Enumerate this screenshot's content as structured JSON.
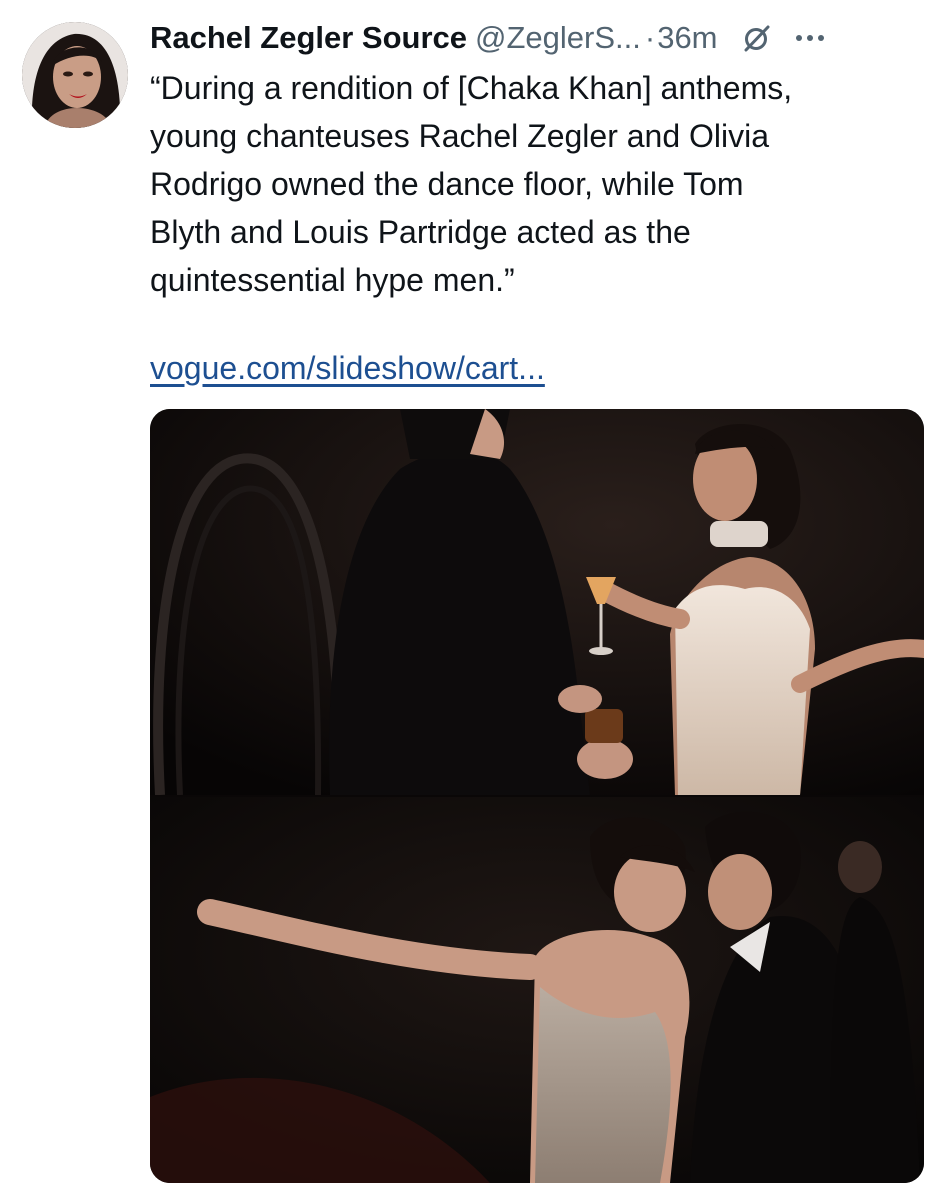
{
  "author": {
    "display_name": "Rachel Zegler Source",
    "handle": "@ZeglerS...",
    "separator": "·",
    "time": "36m",
    "avatar_icon": "profile-photo",
    "grok_icon": "grok-icon",
    "more_icon": "more-options-icon"
  },
  "tweet": {
    "lines": [
      "“During a rendition of [Chaka Khan] anthems,",
      "young chanteuses Rachel Zegler and Olivia",
      "Rodrigo owned the dance floor, while Tom",
      "Blyth and Louis Partridge acted as the",
      "quintessential hype men.”"
    ],
    "link": "vogue.com/slideshow/cart..."
  },
  "colors": {
    "text": "#0f1419",
    "secondary": "#536471",
    "link": "#1d4f91",
    "media_bg": "#0a0707"
  }
}
